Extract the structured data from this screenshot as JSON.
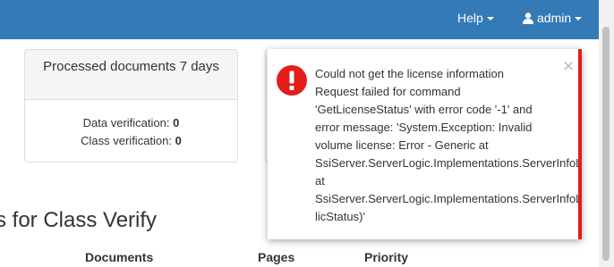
{
  "navbar": {
    "help_label": "Help",
    "admin_label": "admin",
    "bg_color": "#337ab7"
  },
  "panel": {
    "title": "Processed documents 7 days",
    "data_verification_label": "Data verification:",
    "data_verification_value": "0",
    "class_verification_label": "Class verification:",
    "class_verification_value": "0"
  },
  "section": {
    "heading": "s for Class Verify",
    "columns": [
      "Documents",
      "Pages",
      "Priority"
    ]
  },
  "toast": {
    "icon": "exclamation-circle-icon",
    "accent_color": "#e31c1c",
    "close_label": "×",
    "lines": [
      "Could not get the license information",
      "Request failed for command",
      "'GetLicenseStatus' with error code '-1' and",
      "error message: 'System.Exception: Invalid",
      "volume license: Error - Generic at",
      "SsiServer.ServerLogic.Implementations.ServerInfoLo",
      "at",
      "SsiServer.ServerLogic.Implementations.ServerInfoLo",
      "licStatus)'"
    ]
  }
}
